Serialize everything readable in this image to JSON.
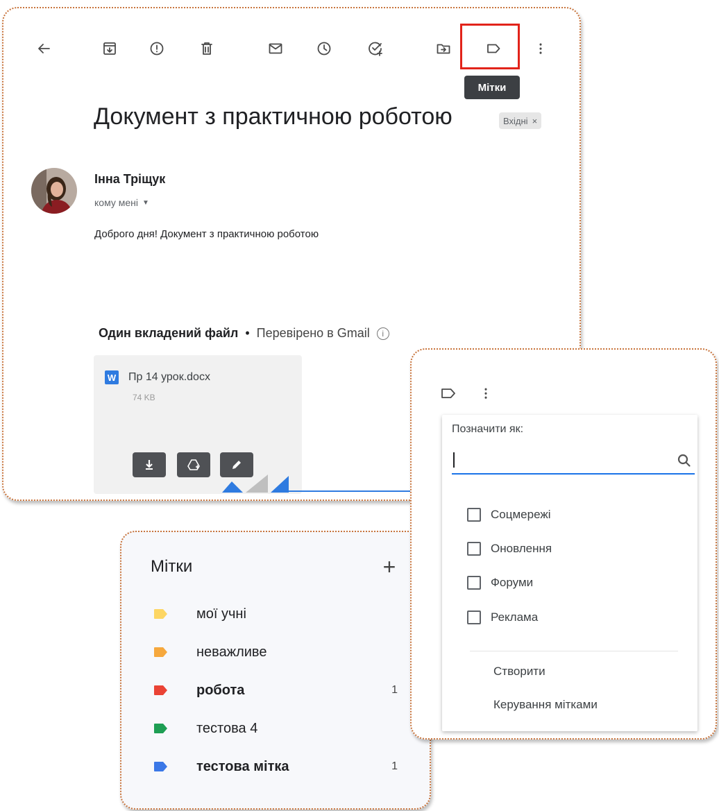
{
  "toolbar": {
    "buttons": [
      "back-arrow-icon",
      "archive-icon",
      "report-spam-icon",
      "delete-icon",
      "mark-unread-icon",
      "snooze-icon",
      "add-task-icon",
      "move-to-icon",
      "label-icon",
      "more-vert-icon"
    ],
    "tooltip": "Мітки",
    "highlight_color": "#e2231a"
  },
  "email": {
    "subject": "Документ з практичною роботою",
    "inbox_chip": "Вхідні",
    "chip_close": "×",
    "sender": "Інна Тріщук",
    "recipient": "кому мені",
    "body": "Доброго дня! Документ з практичною роботою"
  },
  "attachment": {
    "header_bold": "Один вкладений файл",
    "separator": "•",
    "verified": "Перевірено в Gmail",
    "info": "i",
    "file_icon": "W",
    "file_name": "Пр 14 урок.docx",
    "file_size": "74 KB",
    "actions": [
      "download-icon",
      "save-to-drive-icon",
      "edit-icon"
    ],
    "partial_text": "ю"
  },
  "label_dropdown": {
    "title": "Позначити як:",
    "search_icon": "search-icon",
    "options": [
      "Соцмережі",
      "Оновлення",
      "Форуми",
      "Реклама"
    ],
    "create": "Створити",
    "manage": "Керування мітками",
    "accent": "#1a73e8"
  },
  "sidebar_labels": {
    "title": "Мітки",
    "add": "+",
    "items": [
      {
        "name": "мої учні",
        "color": "#fdd663",
        "count": "",
        "bold": false
      },
      {
        "name": "неважливе",
        "color": "#f6a83d",
        "count": "",
        "bold": false
      },
      {
        "name": "робота",
        "color": "#ea4335",
        "count": "1",
        "bold": true
      },
      {
        "name": "тестова 4",
        "color": "#1e9e53",
        "count": "",
        "bold": false
      },
      {
        "name": "тестова мітка",
        "color": "#3b78e7",
        "count": "1",
        "bold": true
      }
    ]
  },
  "colors": {
    "panel_border": "#c8743c",
    "text": "#202124",
    "muted": "#5f6368"
  }
}
